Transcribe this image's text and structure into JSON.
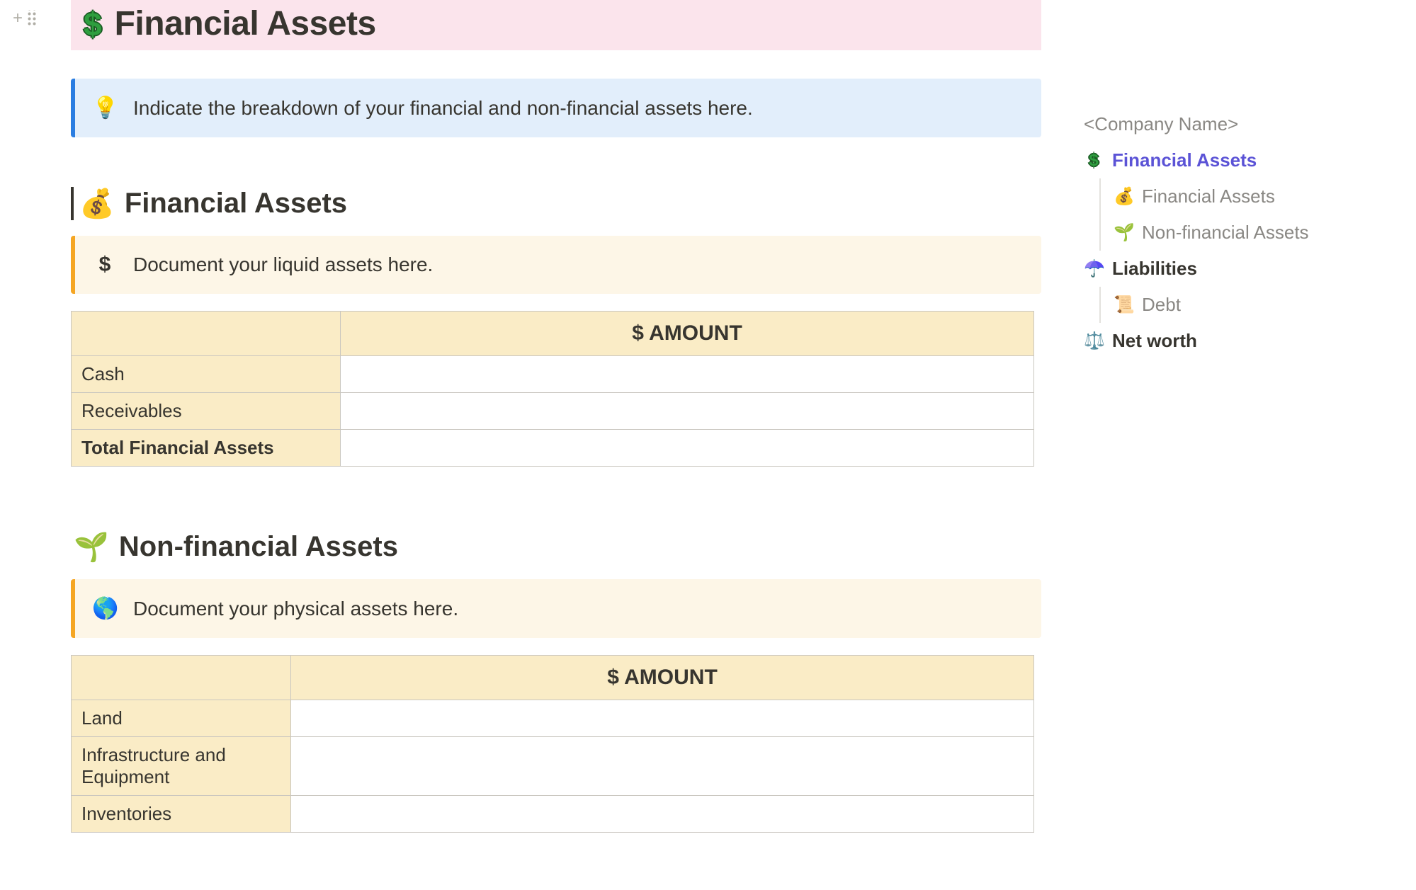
{
  "header": {
    "title": "Financial Assets",
    "icon_name": "dollar-icon"
  },
  "callout_main": {
    "icon": "💡",
    "text": "Indicate the breakdown of your financial and non-financial assets here."
  },
  "section_financial": {
    "icon": "💰",
    "title": "Financial Assets",
    "callout_icon": "$",
    "callout_text": "Document your liquid assets here.",
    "table": {
      "amount_header": "$ AMOUNT",
      "rows": [
        {
          "label": "Cash",
          "value": ""
        },
        {
          "label": "Receivables",
          "value": ""
        }
      ],
      "total_label": "Total Financial Assets",
      "total_value": ""
    }
  },
  "section_nonfinancial": {
    "icon": "🌱",
    "title": "Non-financial Assets",
    "callout_icon": "🌎",
    "callout_text": "Document your physical assets here.",
    "table": {
      "amount_header": "$ AMOUNT",
      "rows": [
        {
          "label": "Land",
          "value": ""
        },
        {
          "label": "Infrastructure and Equipment",
          "value": ""
        },
        {
          "label": "Inventories",
          "value": ""
        }
      ]
    }
  },
  "toc": {
    "company": "<Company Name>",
    "items": [
      {
        "icon": "$",
        "label": "Financial Assets",
        "active": true,
        "bold": true,
        "level": 1,
        "icon_color": "#2e9e3f"
      },
      {
        "icon": "💰",
        "label": "Financial Assets",
        "level": 2
      },
      {
        "icon": "🌱",
        "label": "Non-financial Assets",
        "level": 2
      },
      {
        "icon": "☂️",
        "label": "Liabilities",
        "bold": true,
        "level": 1
      },
      {
        "icon": "📜",
        "label": "Debt",
        "level": 2
      },
      {
        "icon": "⚖️",
        "label": "Net worth",
        "bold": true,
        "level": 1
      }
    ]
  }
}
